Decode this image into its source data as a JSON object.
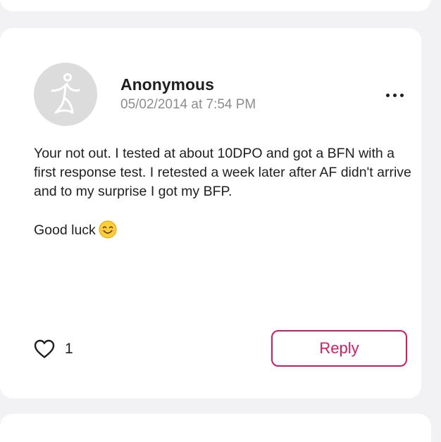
{
  "comment": {
    "author": "Anonymous",
    "timestamp": "05/02/2014 at 7:54 PM",
    "paragraphs": [
      "Your not out. I tested at about 10DPO and got a BFN with a first response test. I retested a week later after AF didn't arrive and to my surprise I got my BFP.",
      "Good luck"
    ],
    "emoji": "smiling-face-icon",
    "likes": "1",
    "reply_label": "Reply"
  },
  "colors": {
    "accent": "#d81b60",
    "text": "#1f1f1f",
    "muted": "#8c8c8c",
    "background": "#f2f2f4",
    "card": "#ffffff",
    "avatar_bg": "#dcdcdc"
  },
  "icons": {
    "avatar": "anonymous-figure-icon",
    "more": "more-options-icon",
    "like": "heart-outline-icon"
  }
}
